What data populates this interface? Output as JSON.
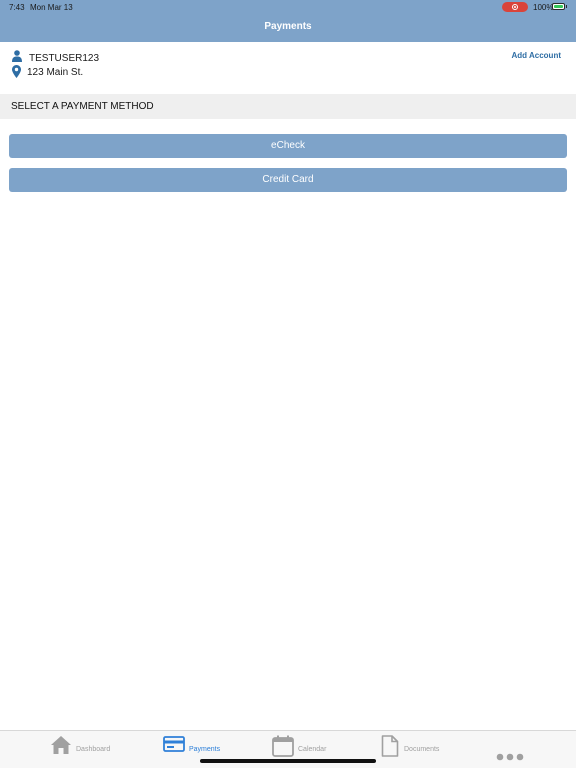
{
  "status_bar": {
    "time": "7:43",
    "date": "Mon Mar 13",
    "battery": "100%"
  },
  "nav": {
    "title": "Payments"
  },
  "account": {
    "user": "TESTUSER123",
    "address": "123 Main St.",
    "add_account_label": "Add Account"
  },
  "section": {
    "title": "SELECT A PAYMENT METHOD"
  },
  "payment_methods": [
    {
      "label": "eCheck"
    },
    {
      "label": "Credit Card"
    }
  ],
  "tab_bar": {
    "tabs": [
      {
        "label": "Dashboard",
        "icon": "home-icon"
      },
      {
        "label": "Payments",
        "icon": "credit-card-icon",
        "active": true
      },
      {
        "label": "Calendar",
        "icon": "calendar-icon"
      },
      {
        "label": "Documents",
        "icon": "document-icon"
      },
      {
        "label": "",
        "icon": "more-icon"
      }
    ]
  },
  "colors": {
    "header": "#7ea3c9",
    "button": "#7ea3c9",
    "link": "#2e6da4",
    "tab_active": "#2f80d8",
    "tab_inactive": "#a0a0a0",
    "recording": "#d9443b",
    "battery_fill": "#34c759"
  }
}
